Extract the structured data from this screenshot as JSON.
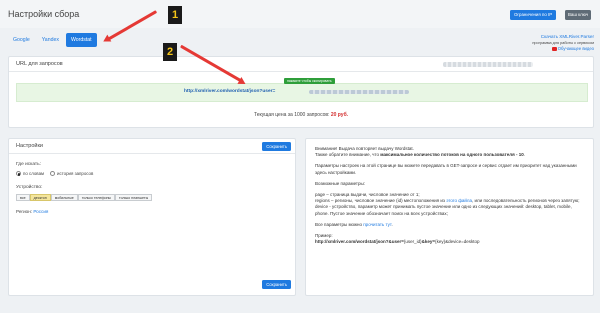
{
  "header": {
    "title": "Настройки сбора",
    "ip_button": "Ограничения по IP",
    "exit_button": "Ваш ключ"
  },
  "tabs": [
    {
      "label": "Google"
    },
    {
      "label": "Yandex"
    },
    {
      "label": "Wordstat"
    }
  ],
  "download": {
    "link": "Скачать XMLRiver.Parser",
    "subtitle": "программа для работы с сервисом",
    "video": "Обучающее видео"
  },
  "url_panel": {
    "title": "URL для запросов",
    "copy_tip": "нажмите чтобы скопировать",
    "api_url": "http://xmlriver.com/wordstat/json?user=",
    "price_text": "Текущая цена за 1000 запросов: ",
    "price_value": "20 руб."
  },
  "settings": {
    "title": "Настройки",
    "save_label": "Сохранить",
    "search_label": "Где искать:",
    "radio_words": "по словам",
    "radio_history": "история запросов",
    "device_label": "Устройство:",
    "devices": [
      "все",
      "десктоп",
      "мобильные",
      "только телефоны",
      "только планшеты"
    ],
    "region_label": "Регион: ",
    "region_value": "Россия"
  },
  "info": {
    "p1a": "Внимание! Выдача повторяет выдачу Wordstat.",
    "p1b": "Также обратите внимание, что ",
    "p1bold": "максимальное количество потоков на одного пользователя - 10",
    "p1c": ".",
    "p2": "Параметры настроек на этой странице вы можете передавать в GET-запросе и сервис отдает им приоритет над указанными здесь настройками.",
    "p3": "Возможные параметры:",
    "p4a": "page – страница выдачи, числовое значение от 1;",
    "p4b": "regions – регионы, числовое значение (id) местоположения из ",
    "p4link": "этого файла",
    "p4c": ", или последовательность регионов через запятую;",
    "p4d": "device - устройство, параметр может принимать пустое значение или одно из следующих значений: desktop, tablet, mobile, phone. Пустое значение обозначает поиск на всех устройствах;",
    "p5a": "Все параметры можно ",
    "p5link": "прочитать тут",
    "p5b": ".",
    "example_label": "Пример:",
    "example_url": "http://xmlriver.com/wordstat/json?&user=",
    "example_url_b": "{user_id}",
    "example_url_c": "&key=",
    "example_url_d": "{key}",
    "example_url_e": "&device=desktop"
  },
  "annotations": {
    "badge1": "1",
    "badge2": "2"
  },
  "colors": {
    "accent": "#1f7ae0",
    "arrow": "#e53935",
    "url_bg": "#e8f6e4",
    "price": "#d32f2f"
  }
}
